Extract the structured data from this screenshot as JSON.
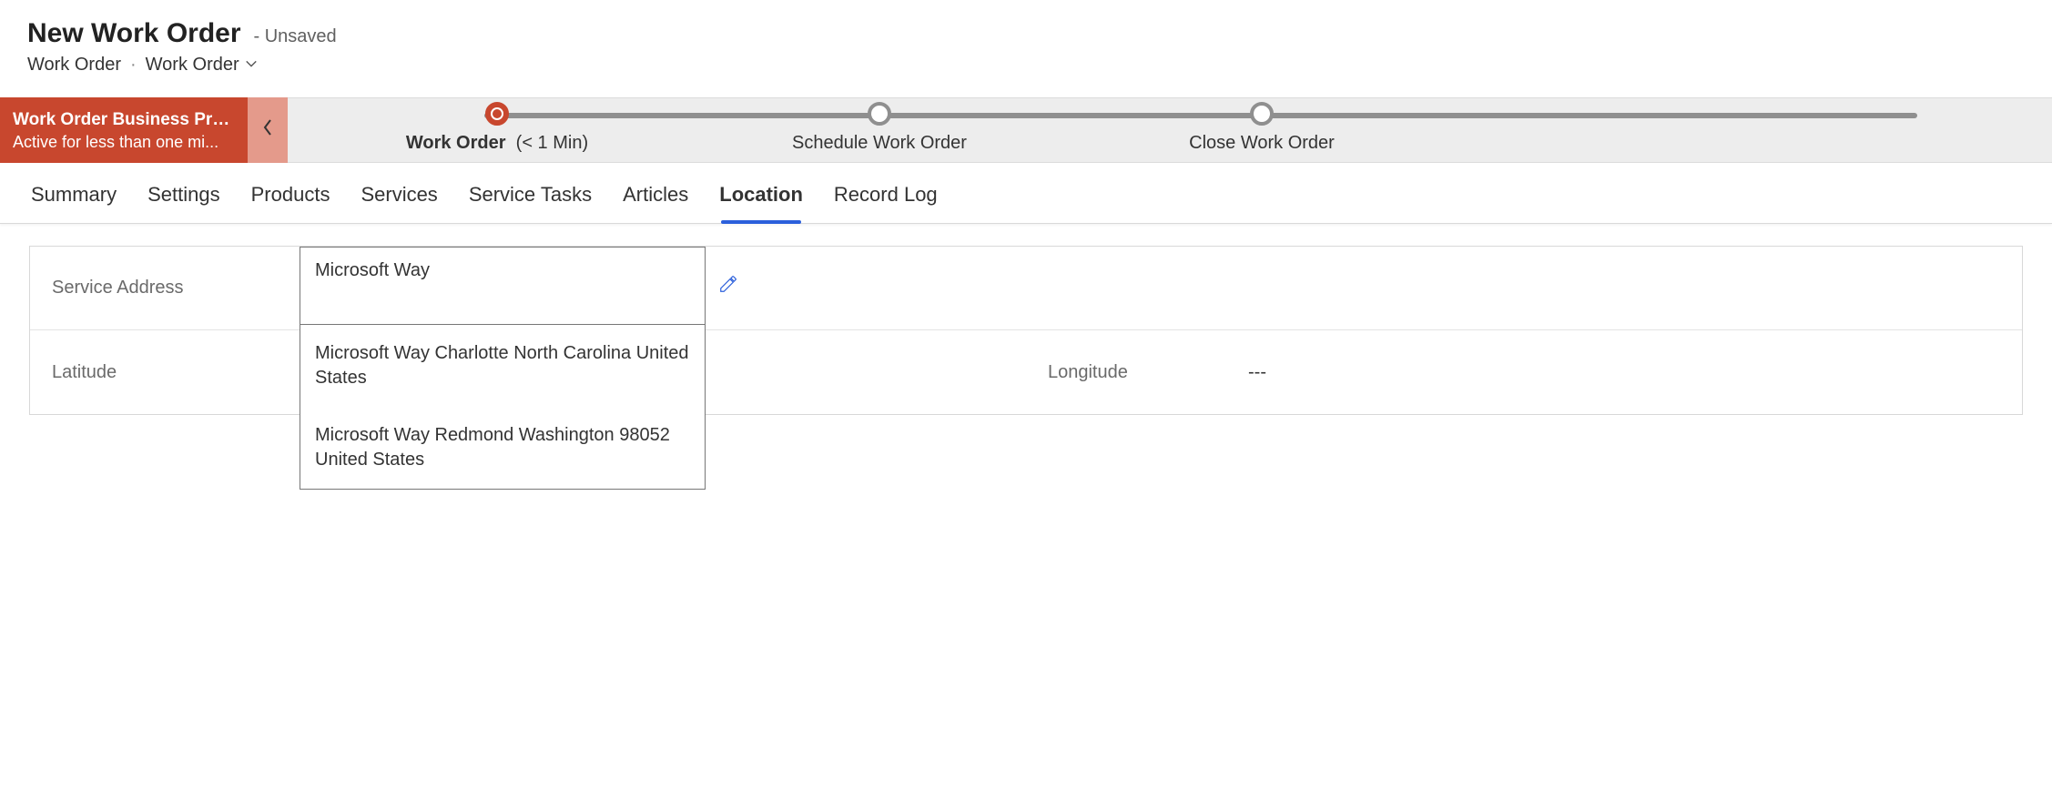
{
  "header": {
    "title": "New Work Order",
    "title_suffix": "- Unsaved",
    "breadcrumb_entity": "Work Order",
    "breadcrumb_form": "Work Order"
  },
  "bpf": {
    "name": "Work Order Business Pro...",
    "duration": "Active for less than one mi...",
    "stages": [
      {
        "label_bold": "Work Order",
        "label_suffix": "(< 1 Min)",
        "active": true
      },
      {
        "label": "Schedule Work Order"
      },
      {
        "label": "Close Work Order"
      }
    ]
  },
  "tabs": [
    "Summary",
    "Settings",
    "Products",
    "Services",
    "Service Tasks",
    "Articles",
    "Location",
    "Record Log"
  ],
  "active_tab": "Location",
  "form": {
    "service_address_label": "Service Address",
    "service_address_value": "Microsoft Way",
    "latitude_label": "Latitude",
    "latitude_value": "",
    "longitude_label": "Longitude",
    "longitude_value": "---"
  },
  "address_suggestions": [
    "Microsoft Way Charlotte North Carolina United States",
    "Microsoft Way Redmond Washington 98052 United States"
  ]
}
